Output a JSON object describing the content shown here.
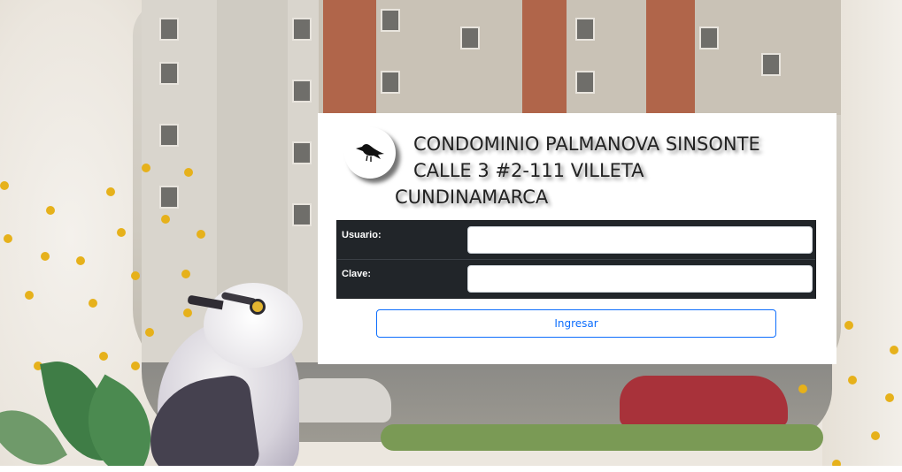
{
  "colors": {
    "table_bg": "#212529",
    "button_border": "#0d6efd",
    "button_text": "#0d6efd",
    "accent_dots": "#e6b11b"
  },
  "logo": {
    "icon": "bird-icon"
  },
  "header": {
    "line1": "CONDOMINIO PALMANOVA SINSONTE",
    "line2": "CALLE 3 #2-111 VILLETA",
    "line3": "CUNDINAMARCA"
  },
  "form": {
    "username_label": "Usuario:",
    "username_value": "",
    "password_label": "Clave:",
    "password_value": "",
    "submit_label": "Ingresar"
  }
}
